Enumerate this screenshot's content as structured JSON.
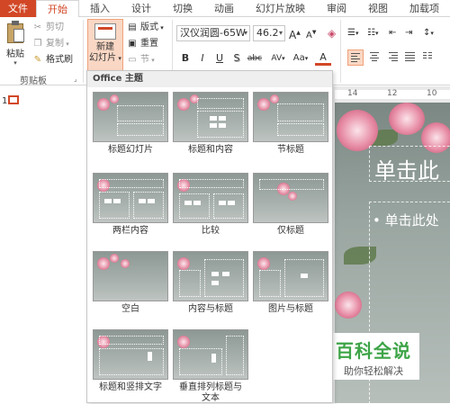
{
  "tabs": [
    "文件",
    "开始",
    "插入",
    "设计",
    "切换",
    "动画",
    "幻灯片放映",
    "审阅",
    "视图",
    "加载项"
  ],
  "clipboard": {
    "paste_label": "粘贴",
    "cut_label": "剪切",
    "copy_label": "复制",
    "format_painter_label": "格式刷",
    "group_label": "剪贴板"
  },
  "slides_group": {
    "new_slide_label": "新建\n幻灯片",
    "layout_label": "版式",
    "reset_label": "重置",
    "section_label": "节"
  },
  "font": {
    "family": "汉仪润圆-65W",
    "size": "46.2",
    "bold": "B",
    "italic": "I",
    "underline": "U",
    "shadow": "S",
    "strikethrough": "abc",
    "spacing": "AV"
  },
  "slide_pane": {
    "slide_number": "1"
  },
  "ruler": {
    "marks": [
      "14",
      "12",
      "10"
    ]
  },
  "canvas": {
    "title_placeholder": "单击此",
    "bullet_placeholder": "• 单击此处"
  },
  "gallery": {
    "header": "Office 主题",
    "layouts": [
      {
        "label": "标题幻灯片"
      },
      {
        "label": "标题和内容"
      },
      {
        "label": "节标题"
      },
      {
        "label": "两栏内容"
      },
      {
        "label": "比较"
      },
      {
        "label": "仅标题"
      },
      {
        "label": "空白"
      },
      {
        "label": "内容与标题"
      },
      {
        "label": "图片与标题"
      },
      {
        "label": "标题和竖排文字"
      },
      {
        "label": "垂直排列标题与\n文本"
      }
    ]
  },
  "watermark": {
    "main": "百科全说",
    "sub": "助你轻松解决"
  },
  "colors": {
    "accent": "#d24726",
    "watermark_green": "#3da447"
  }
}
